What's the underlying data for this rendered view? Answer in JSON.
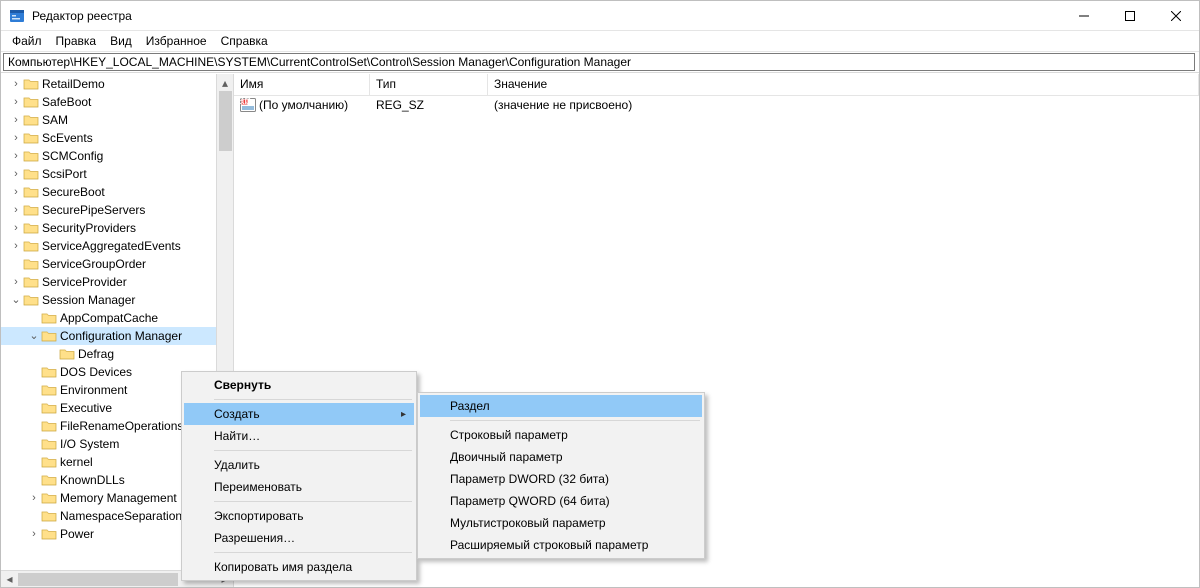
{
  "window": {
    "title": "Редактор реестра"
  },
  "menu": {
    "file": "Файл",
    "edit": "Правка",
    "view": "Вид",
    "fav": "Избранное",
    "help": "Справка"
  },
  "address": "Компьютер\\HKEY_LOCAL_MACHINE\\SYSTEM\\CurrentControlSet\\Control\\Session Manager\\Configuration Manager",
  "headers": {
    "name": "Имя",
    "type": "Тип",
    "value": "Значение"
  },
  "row": {
    "name": "(По умолчанию)",
    "type": "REG_SZ",
    "value": "(значение не присвоено)"
  },
  "tree": {
    "RetailDemo": "RetailDemo",
    "SafeBoot": "SafeBoot",
    "SAM": "SAM",
    "ScEvents": "ScEvents",
    "SCMConfig": "SCMConfig",
    "ScsiPort": "ScsiPort",
    "SecureBoot": "SecureBoot",
    "SecurePipeServers": "SecurePipeServers",
    "SecurityProviders": "SecurityProviders",
    "ServiceAggregatedEvents": "ServiceAggregatedEvents",
    "ServiceGroupOrder": "ServiceGroupOrder",
    "ServiceProvider": "ServiceProvider",
    "SessionManager": "Session Manager",
    "AppCompatCache": "AppCompatCache",
    "ConfigurationManager": "Configuration Manager",
    "Defrag": "Defrag",
    "DOSDevices": "DOS Devices",
    "Environment": "Environment",
    "Executive": "Executive",
    "FileRenameOperations": "FileRenameOperations",
    "IOSystem": "I/O System",
    "kernel": "kernel",
    "KnownDLLs": "KnownDLLs",
    "MemoryManagement": "Memory Management",
    "NamespaceSeparation": "NamespaceSeparation",
    "Power": "Power"
  },
  "ctx1": {
    "collapse": "Свернуть",
    "new": "Создать",
    "find": "Найти…",
    "delete": "Удалить",
    "rename": "Переименовать",
    "export": "Экспортировать",
    "perm": "Разрешения…",
    "copy": "Копировать имя раздела"
  },
  "ctx2": {
    "key": "Раздел",
    "string": "Строковый параметр",
    "binary": "Двоичный параметр",
    "dword": "Параметр DWORD (32 бита)",
    "qword": "Параметр QWORD (64 бита)",
    "multi": "Мультистроковый параметр",
    "expand": "Расширяемый строковый параметр"
  }
}
